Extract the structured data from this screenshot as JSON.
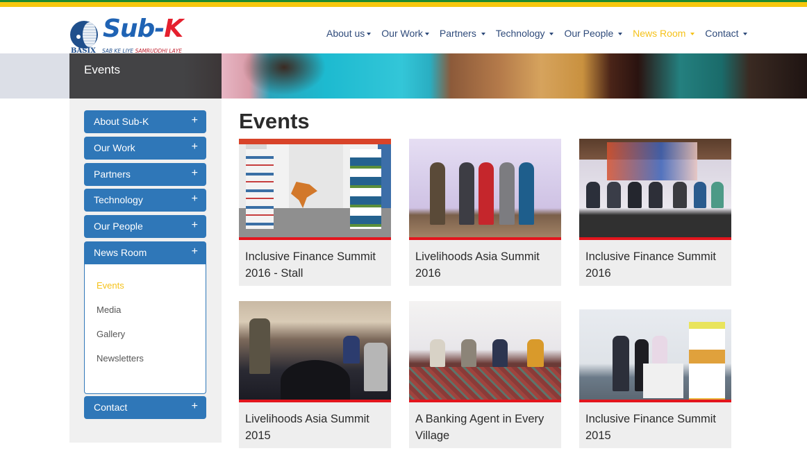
{
  "header": {
    "logo": {
      "brand_main": "Sub-",
      "brand_accent": "K",
      "sub_brand": "BASIX",
      "tagline_part1": "SAB KE LIYE ",
      "tagline_part2": "SAMRUDDHI LAYE"
    },
    "nav": [
      {
        "label": "About us",
        "active": false
      },
      {
        "label": "Our Work",
        "active": false
      },
      {
        "label": "Partners",
        "active": false
      },
      {
        "label": "Technology",
        "active": false
      },
      {
        "label": "Our People",
        "active": false
      },
      {
        "label": "News Room",
        "active": true
      },
      {
        "label": "Contact",
        "active": false
      }
    ]
  },
  "banner": {
    "title": "Events"
  },
  "sidebar": {
    "sections": [
      {
        "label": "About Sub-K",
        "icon": "plus-icon"
      },
      {
        "label": "Our Work",
        "icon": "plus-icon"
      },
      {
        "label": "Partners",
        "icon": "plus-icon"
      },
      {
        "label": "Technology",
        "icon": "plus-icon"
      },
      {
        "label": "Our People",
        "icon": "plus-icon"
      },
      {
        "label": "News Room",
        "icon": "plus-icon",
        "expanded": true
      },
      {
        "label": "Contact",
        "icon": "plus-icon"
      }
    ],
    "news_room_items": [
      {
        "label": "Events",
        "active": true
      },
      {
        "label": "Media",
        "active": false
      },
      {
        "label": "Gallery",
        "active": false
      },
      {
        "label": "Newsletters",
        "active": false
      }
    ],
    "plus_glyph": "+"
  },
  "main": {
    "title": "Events",
    "events": [
      {
        "caption": "Inclusive Finance Summit 2016 - Stall"
      },
      {
        "caption": "Livelihoods Asia Summit 2016"
      },
      {
        "caption": "Inclusive Finance Summit 2016"
      },
      {
        "caption": "Livelihoods Asia Summit 2015"
      },
      {
        "caption": "A Banking Agent in Every Village"
      },
      {
        "caption": "Inclusive Finance Summit 2015"
      }
    ]
  },
  "colors": {
    "primary_blue": "#2f77b8",
    "active_yellow": "#f5c21b",
    "accent_red": "#e3151d",
    "top_green": "#1f8a2e",
    "top_yellow": "#f7c70d"
  }
}
